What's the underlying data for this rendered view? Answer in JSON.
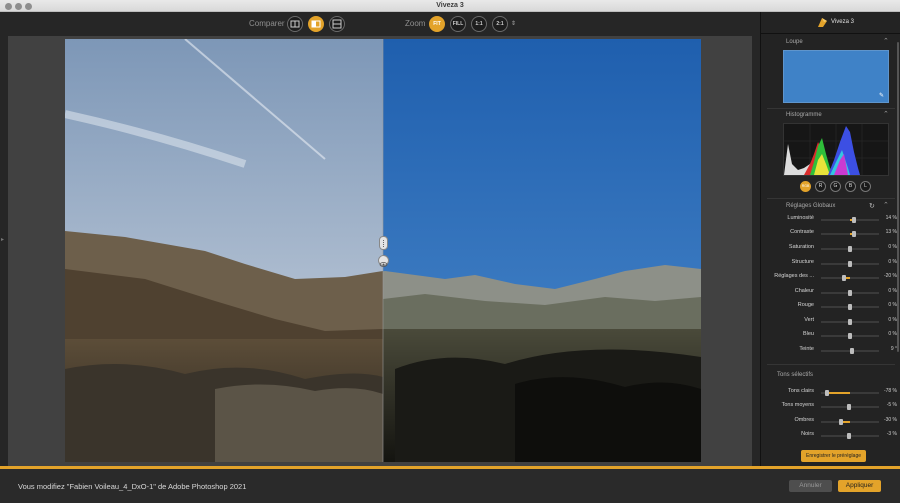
{
  "window": {
    "title": "Viveza 3"
  },
  "toolbar": {
    "compare_label": "Comparer",
    "zoom_label": "Zoom",
    "zoom_buttons": [
      "FIT",
      "FILL",
      "1:1",
      "2:1"
    ],
    "zoom_arrow": "⇕"
  },
  "panel": {
    "app_name": "Viveza 3",
    "loupe_title": "Loupe",
    "histogram_title": "Histogramme",
    "channels": [
      "RGB",
      "R",
      "G",
      "B",
      "L"
    ],
    "global_title": "Réglages Globaux",
    "global_sliders": [
      {
        "label": "Luminosité",
        "value": "14 %"
      },
      {
        "label": "Contraste",
        "value": "13 %"
      },
      {
        "label": "Saturation",
        "value": "0 %"
      },
      {
        "label": "Structure",
        "value": "0 %"
      },
      {
        "label": "Réglages des ...",
        "value": "-20 %"
      },
      {
        "label": "Chaleur",
        "value": "0 %"
      },
      {
        "label": "Rouge",
        "value": "0 %"
      },
      {
        "label": "Vert",
        "value": "0 %"
      },
      {
        "label": "Bleu",
        "value": "0 %"
      },
      {
        "label": "Teinte",
        "value": "9 °"
      }
    ],
    "selective_title": "Tons sélectifs",
    "selective_sliders": [
      {
        "label": "Tons clairs",
        "value": "-78 %"
      },
      {
        "label": "Tons moyens",
        "value": "-5 %"
      },
      {
        "label": "Ombres",
        "value": "-30 %"
      },
      {
        "label": "Noirs",
        "value": "-3 %"
      }
    ],
    "save_preset": "Enregistrer le préréglage"
  },
  "bottom": {
    "status": "Vous modifiez \"Fabien Voileau_4_DxO-1\" de Adobe Photoshop 2021",
    "cancel": "Annuler",
    "apply": "Appliquer"
  },
  "colors": {
    "accent": "#e3a32a",
    "sky": "#3d78bd",
    "background": "#262626"
  }
}
